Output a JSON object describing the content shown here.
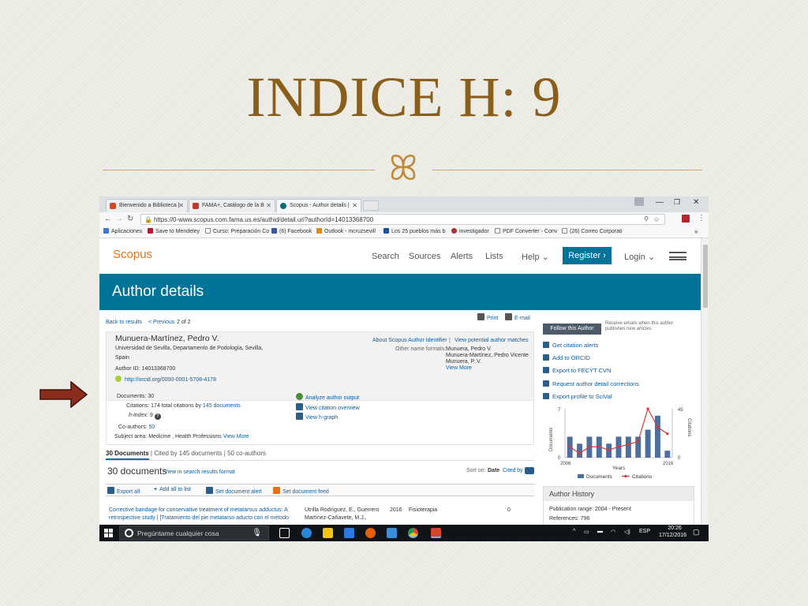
{
  "slide": {
    "title": "INDICE H: 9",
    "ornament": "ꕤ"
  },
  "browser": {
    "tabs": [
      {
        "label": "Bienvenido a Biblioteca |",
        "color": "#d8432a"
      },
      {
        "label": "FAMA+, Catálogo de la B",
        "color": "#c0392b"
      },
      {
        "label": "Scopus - Author details |",
        "color": "#0f6c73"
      }
    ],
    "url": "https://0-www.scopus.com.fama.us.es/authid/detail.uri?authorId=14013368700",
    "bookmarks": [
      {
        "label": "Aplicaciones",
        "color": "#3c78d8"
      },
      {
        "label": "Save to Mendeley",
        "color": "#c8102e"
      },
      {
        "label": "Curso: Preparación Co",
        "color": "#888888"
      },
      {
        "label": "(6) Facebook",
        "color": "#3b5998"
      },
      {
        "label": "Outlook - mcruzsevill",
        "color": "#e48c00"
      },
      {
        "label": "Los 25 pueblos más b",
        "color": "#1e4f9c"
      },
      {
        "label": "investigador",
        "color": "#b03030"
      },
      {
        "label": "PDF Converter - Conv",
        "color": "#d04040"
      },
      {
        "label": "(26) Correo Corporati",
        "color": "#444444"
      }
    ]
  },
  "scopus": {
    "logo": "Scopus",
    "nav": [
      "Search",
      "Sources",
      "Alerts",
      "Lists",
      "Help ⌄",
      "Login ⌄"
    ],
    "register": "Register ›",
    "banner_title": "Author details",
    "back_to_results": "Back to results",
    "previous": "< Previous",
    "page_of": "2 of 2",
    "print": "Print",
    "email": "E-mail",
    "author": {
      "name": "Munuera-Martínez, Pedro V.",
      "affiliation_1": "Universidad de Sevilla, Departamento de Podología, Sevilla,",
      "affiliation_2": "Spain",
      "author_id": "Author ID: 14013368700",
      "orcid": "http://orcid.org/0000-0001-5708-4178",
      "about_identifier": "About Scopus Author Identifier",
      "separator": "|",
      "view_matches": "View potential author matches",
      "other_formats_label": "Other name formats:",
      "other_formats": [
        "Munuera, Pedro V.",
        "Munuera-Martínez, Pedro Vicente",
        "Munuera, P. V."
      ],
      "view_more": "View More"
    },
    "metrics": {
      "documents_label": "Documents:",
      "documents_value": "30",
      "citations_label": "Citations:",
      "citations_value": "174 total citations by",
      "citations_link": "145 documents",
      "hindex_label": "h-index:",
      "hindex_value": "9",
      "coauthors_label": "Co-authors:",
      "coauthors_value": "50",
      "subject_label": "Subject area:",
      "subject_value": "Medicine ,  Health Professions",
      "subject_more": "View More",
      "analyze": "Analyze author output",
      "citation_overview": "View citation overview",
      "hgraph": "View h-graph"
    },
    "doc_tabs": {
      "active": "30 Documents",
      "cited_by": "Cited by 145 documents",
      "coauthors": "50 co-authors",
      "sep": "|"
    },
    "docs_header": {
      "count": "30 documents",
      "view_search": "View in search results format",
      "sort_label": "Sort on:",
      "sort_date": "Date",
      "sort_cited": "Cited by"
    },
    "actions": {
      "export_all": "Export all",
      "add_to_list": "Add all to list",
      "set_alert": "Set document alert",
      "set_feed": "Set document feed"
    },
    "result": {
      "title_1": "Corrective bandage for conservative treatment of metatarsus adductus: A",
      "title_2": "retrospective study | [Tratamiento del pie metatarso aducto con el método",
      "authors_1": "Utrilla Rodríguez, E., Guerrero",
      "authors_2": "Martínez-Cañavete, M.J.,",
      "year": "2016",
      "source": "Fisioterapia",
      "cited": "0"
    },
    "sidebar": {
      "follow": "Follow this Author",
      "follow_note_1": "Receive emails when this author",
      "follow_note_2": "publishes new articles",
      "links": [
        "Get citation alerts",
        "Add to ORCID",
        "Export to FECYT CVN",
        "Request author detail corrections",
        "Export profile to SciVal"
      ],
      "history_title": "Author History",
      "history_range": "Publication range: 2004 - Present",
      "history_refs": "References: 796"
    }
  },
  "chart_data": {
    "type": "bar",
    "x_start_label": "2006",
    "x_end_label": "2016",
    "xlabel": "Years",
    "ylabel_left": "Documents",
    "ylabel_right": "Citations",
    "y_left_ticks": [
      "7",
      "0"
    ],
    "y_right_ticks": [
      "45",
      "0"
    ],
    "ylim_left": [
      0,
      7
    ],
    "ylim_right": [
      0,
      45
    ],
    "legend": [
      "Documents",
      "Citations"
    ],
    "series": [
      {
        "name": "Documents",
        "type": "bar",
        "values": [
          3,
          2,
          3,
          3,
          2,
          3,
          3,
          3,
          4,
          6,
          1
        ]
      },
      {
        "name": "Citations",
        "type": "line",
        "values": [
          10,
          4,
          10,
          10,
          7,
          10,
          12,
          15,
          45,
          28,
          22
        ]
      }
    ],
    "colors": {
      "documents": "#4c6f9e",
      "citations": "#d43b3b"
    }
  },
  "taskbar": {
    "search_placeholder": "Pregúntame cualquier cosa",
    "lang": "ESP",
    "time": "20:26",
    "date": "17/12/2016"
  }
}
